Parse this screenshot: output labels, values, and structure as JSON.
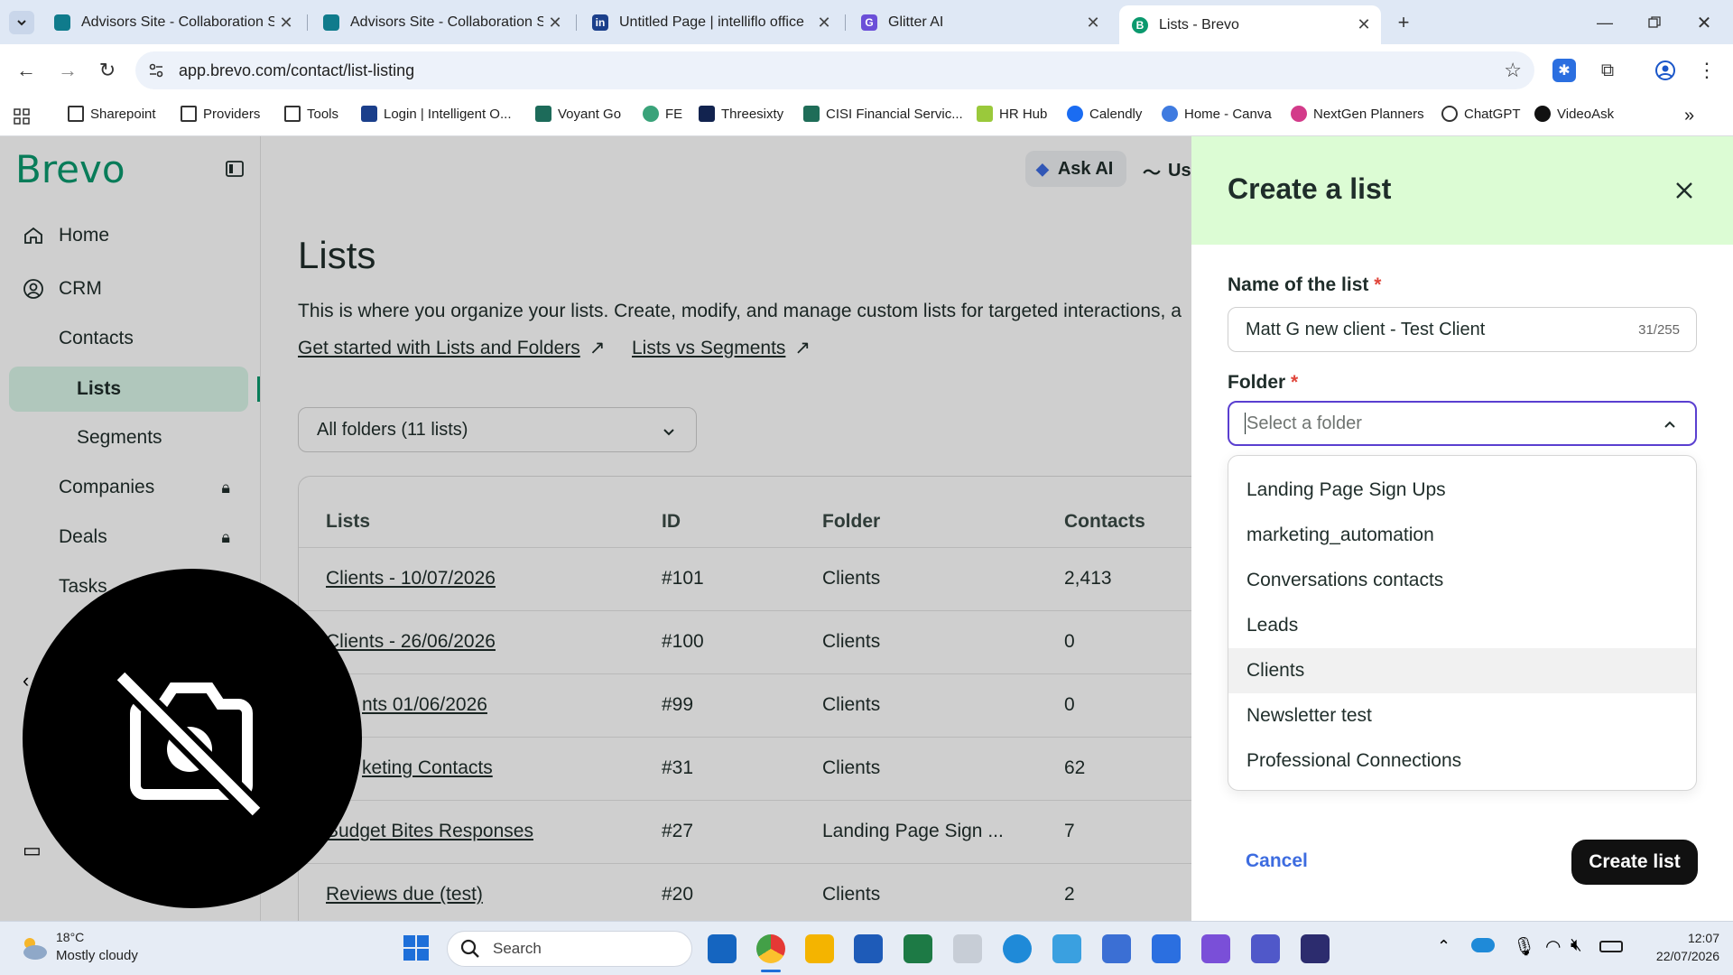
{
  "browser": {
    "tabs": [
      {
        "title": "Advisors Site - Collaboration Site",
        "color": "#0f7b8c"
      },
      {
        "title": "Advisors Site - Collaboration Site",
        "color": "#0f7b8c"
      },
      {
        "title": "Untitled Page | intelliflo office",
        "color": "#1b3f8b"
      },
      {
        "title": "Glitter AI",
        "color": "#6b4fd8"
      },
      {
        "title": "Lists - Brevo",
        "color": "#0b996e"
      }
    ],
    "url": "app.brevo.com/contact/list-listing",
    "bookmarks": [
      "Sharepoint",
      "Providers",
      "Tools",
      "Login | Intelligent O...",
      "Voyant Go",
      "FE",
      "Threesixty",
      "CISI Financial Servic...",
      "HR Hub",
      "Calendly",
      "Home - Canva",
      "NextGen Planners",
      "ChatGPT",
      "VideoAsk"
    ]
  },
  "sidebar": {
    "logo": "Brevo",
    "items": [
      "Home",
      "CRM",
      "Contacts",
      "Lists",
      "Segments",
      "Companies",
      "Deals",
      "Tasks"
    ]
  },
  "header": {
    "ask_ai": "Ask AI",
    "usage": "Us"
  },
  "main": {
    "title": "Lists",
    "description": "This is where you organize your lists. Create, modify, and manage custom lists for targeted interactions, a",
    "link1": "Get started with Lists and Folders",
    "link2": "Lists vs Segments",
    "folder_filter": "All folders (11 lists)",
    "columns": [
      "Lists",
      "ID",
      "Folder",
      "Contacts"
    ],
    "rows": [
      [
        "Clients - 10/07/2026",
        "#101",
        "Clients",
        "2,413"
      ],
      [
        "Clients - 26/06/2026",
        "#100",
        "Clients",
        "0"
      ],
      [
        "nts 01/06/2026",
        "#99",
        "Clients",
        "0"
      ],
      [
        "keting Contacts",
        "#31",
        "Clients",
        "62"
      ],
      [
        "Budget Bites Responses",
        "#27",
        "Landing Page Sign ...",
        "7"
      ],
      [
        "Reviews due (test)",
        "#20",
        "Clients",
        "2"
      ]
    ]
  },
  "panel": {
    "title": "Create a list",
    "name_label": "Name of the list",
    "name_value": "Matt G new client - Test Client",
    "name_counter": "31/255",
    "folder_label": "Folder",
    "folder_placeholder": "Select a folder",
    "options": [
      "Landing Page Sign Ups",
      "marketing_automation",
      "Conversations contacts",
      "Leads",
      "Clients",
      "Newsletter test",
      "Professional Connections"
    ],
    "highlighted_option": "Clients",
    "cancel": "Cancel",
    "create": "Create list"
  },
  "taskbar": {
    "weather_temp": "18°C",
    "weather_desc": "Mostly cloudy",
    "search": "Search",
    "time": "12:07",
    "date": "22/07/2026"
  }
}
